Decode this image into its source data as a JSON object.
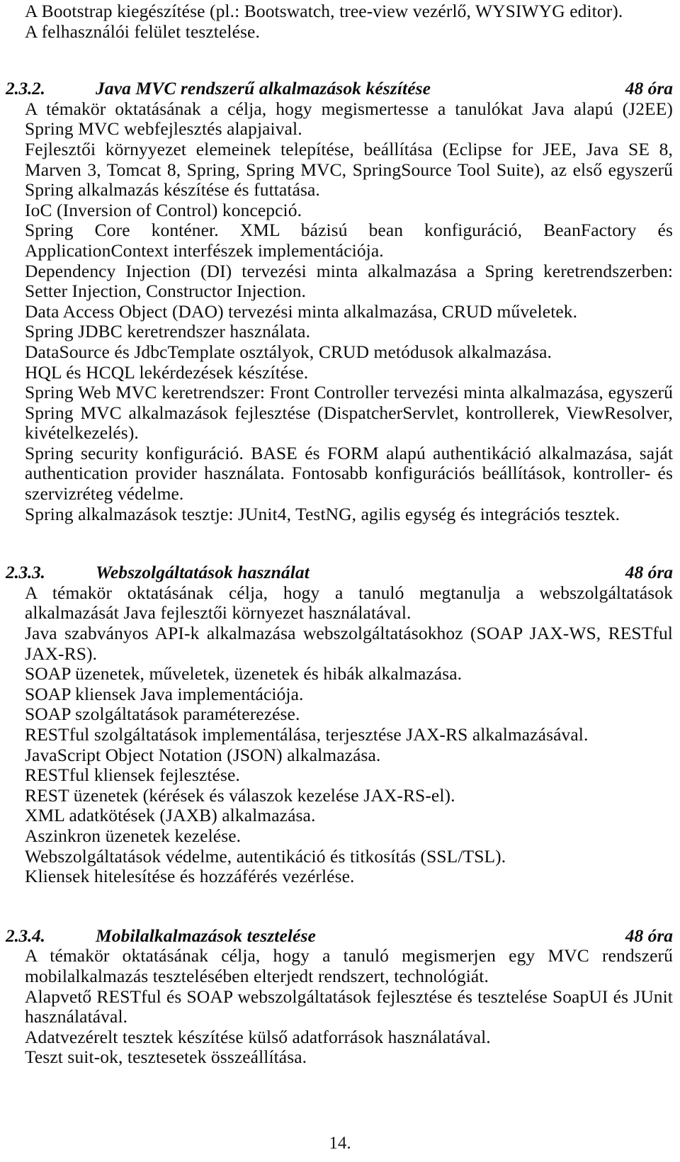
{
  "document": {
    "language": "hu",
    "page_number": "14.",
    "text_color": "#0d0d0d",
    "background_color": "#ffffff"
  },
  "intro_lines": [
    "A Bootstrap kiegészítése (pl.: Bootswatch, tree-view vezérlő, WYSIWYG editor).",
    "A felhasználói felület tesztelése."
  ],
  "sections": [
    {
      "number": "2.3.2.",
      "title": "Java MVC rendszerű alkalmazások készítése",
      "hours": "48 óra",
      "paragraphs": [
        "A témakör oktatásának a célja, hogy megismertesse a tanulókat Java alapú (J2EE) Spring MVC webfejlesztés alapjaival.",
        "Fejlesztői környyezet elemeinek telepítése, beállítása (Eclipse for JEE, Java SE 8, Marven 3, Tomcat 8, Spring, Spring MVC, SpringSource Tool Suite), az első egyszerű Spring alkalmazás készítése és futtatása.",
        "IoC (Inversion of Control) koncepció.",
        "Spring Core konténer. XML bázisú bean konfiguráció, BeanFactory és ApplicationContext interfészek implementációja.",
        "Dependency Injection (DI) tervezési minta alkalmazása a Spring keretrendszerben: Setter Injection, Constructor Injection.",
        "Data Access Object (DAO) tervezési minta alkalmazása, CRUD műveletek.",
        "Spring JDBC keretrendszer használata.",
        "DataSource és JdbcTemplate osztályok, CRUD metódusok alkalmazása.",
        "HQL és HCQL lekérdezések készítése.",
        "Spring Web MVC keretrendszer: Front Controller tervezési minta alkalmazása, egyszerű Spring MVC alkalmazások fejlesztése (DispatcherServlet, kontrollerek, ViewResolver, kivételkezelés).",
        "Spring security konfiguráció. BASE és FORM alapú authentikáció alkalmazása, saját authentication provider használata. Fontosabb konfigurációs beállítások, kontroller- és szervizréteg védelme.",
        "Spring alkalmazások tesztje: JUnit4, TestNG, agilis egység és integrációs tesztek."
      ]
    },
    {
      "number": "2.3.3.",
      "title": "Webszolgáltatások használat",
      "hours": "48 óra",
      "paragraphs": [
        "A témakör oktatásának célja, hogy a tanuló megtanulja a webszolgáltatások alkalmazását Java fejlesztői környezet használatával.",
        "Java szabványos API-k alkalmazása webszolgáltatásokhoz (SOAP JAX-WS, RESTful JAX-RS).",
        "SOAP üzenetek, műveletek, üzenetek és hibák alkalmazása.",
        "SOAP kliensek Java implementációja.",
        "SOAP szolgáltatások paraméterezése.",
        "RESTful szolgáltatások implementálása, terjesztése JAX-RS alkalmazásával.",
        "JavaScript Object Notation (JSON) alkalmazása.",
        "RESTful kliensek fejlesztése.",
        "REST üzenetek (kérések és válaszok kezelése JAX-RS-el).",
        "XML adatkötések (JAXB) alkalmazása.",
        "Aszinkron üzenetek kezelése.",
        "Webszolgáltatások védelme, autentikáció és titkosítás (SSL/TSL).",
        "Kliensek hitelesítése és hozzáférés vezérlése."
      ]
    },
    {
      "number": "2.3.4.",
      "title": "Mobilalkalmazások tesztelése",
      "hours": "48 óra",
      "paragraphs": [
        "A témakör oktatásának célja, hogy a tanuló megismerjen egy MVC rendszerű mobilalkalmazás tesztelésében elterjedt rendszert, technológiát.",
        "Alapvető RESTful és SOAP webszolgáltatások fejlesztése és tesztelése SoapUI és JUnit használatával.",
        "Adatvezérelt tesztek készítése külső adatforrások használatával.",
        "Teszt suit-ok, tesztesetek összeállítása."
      ]
    }
  ]
}
